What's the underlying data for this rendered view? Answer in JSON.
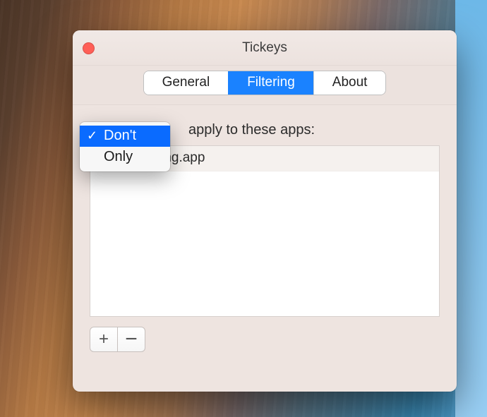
{
  "window": {
    "title": "Tickeys"
  },
  "tabs": {
    "general": "General",
    "filtering": "Filtering",
    "about": "About",
    "active": "filtering"
  },
  "filter": {
    "logic_selected": "Don't",
    "label_rest": "apply to these apps:"
  },
  "dropdown": {
    "options": {
      "dont": "Don't",
      "only": "Only"
    }
  },
  "apps": {
    "items": {
      "0": "AliWangwang.app"
    }
  },
  "buttons": {
    "add": "+",
    "remove": "−"
  }
}
